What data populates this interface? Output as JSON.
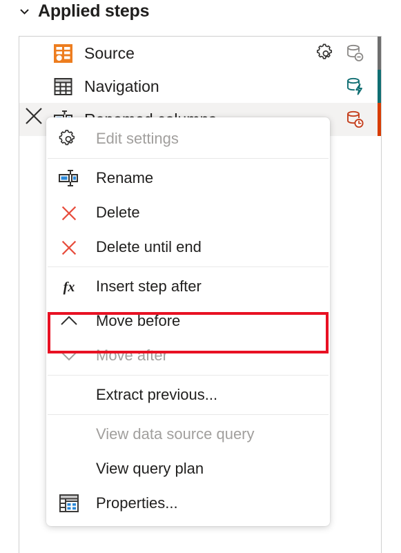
{
  "header": {
    "title": "Applied steps",
    "expand_icon": "chevron-down-icon",
    "expanded": true
  },
  "applied_steps": {
    "delete_step_icon": "close-x-icon",
    "items": [
      {
        "label": "Source",
        "step_icon": "source-orange-icon",
        "has_gear": true,
        "gear_icon": "gear-icon",
        "status_icon": "database-minus-icon",
        "status_color": "#8a8886",
        "edge_color": "#6e6e6e",
        "selected": false
      },
      {
        "label": "Navigation",
        "step_icon": "table-grid-icon",
        "has_gear": false,
        "gear_icon": "",
        "status_icon": "database-lightning-icon",
        "status_color": "#0f6e72",
        "edge_color": "#0f6e72",
        "selected": false
      },
      {
        "label": "Renamed columns",
        "step_icon": "rename-columns-icon",
        "has_gear": false,
        "gear_icon": "",
        "status_icon": "database-clock-icon",
        "status_color": "#c43e1c",
        "edge_color": "#d83b01",
        "selected": true
      }
    ]
  },
  "context_menu": {
    "highlight_color": "#e81123",
    "highlighted_item": "Move before",
    "groups": [
      {
        "items": [
          {
            "label": "Edit settings",
            "icon": "gear-icon",
            "disabled": true
          }
        ]
      },
      {
        "items": [
          {
            "label": "Rename",
            "icon": "rename-icon",
            "disabled": false
          },
          {
            "label": "Delete",
            "icon": "red-x-icon",
            "disabled": false
          },
          {
            "label": "Delete until end",
            "icon": "red-x-icon",
            "disabled": false
          }
        ]
      },
      {
        "items": [
          {
            "label": "Insert step after",
            "icon": "fx-icon",
            "disabled": false
          },
          {
            "label": "Move before",
            "icon": "chevron-up-icon",
            "disabled": false
          },
          {
            "label": "Move after",
            "icon": "chevron-down-icon",
            "disabled": true
          }
        ]
      },
      {
        "items": [
          {
            "label": "Extract previous...",
            "icon": "",
            "disabled": false
          }
        ]
      },
      {
        "items": [
          {
            "label": "View data source query",
            "icon": "",
            "disabled": true
          },
          {
            "label": "View query plan",
            "icon": "",
            "disabled": false
          },
          {
            "label": "Properties...",
            "icon": "properties-icon",
            "disabled": false
          }
        ]
      }
    ]
  }
}
